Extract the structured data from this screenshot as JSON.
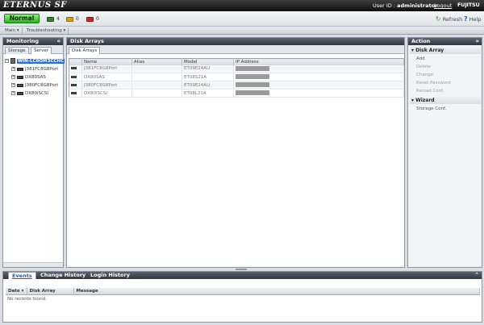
{
  "header": {
    "brand": "ETERNUS SF",
    "user_label": "User ID : ",
    "user_id": "administrator",
    "logout": "Logout",
    "vendor": "FUJITSU"
  },
  "status": {
    "normal": "Normal",
    "counters": [
      {
        "icon": "normal-status-icon",
        "value": "4",
        "color": "#3a7a32"
      },
      {
        "icon": "warning-status-icon",
        "value": "0",
        "color": "#d2a21c"
      },
      {
        "icon": "error-status-icon",
        "value": "0",
        "color": "#cc2a1f"
      }
    ],
    "refresh": "Refresh",
    "help": "Help"
  },
  "menu": [
    "Main",
    "Troubleshooting"
  ],
  "monitoring": {
    "title": "Monitoring",
    "tabs": [
      "Storage",
      "Server"
    ],
    "tree": {
      "root": "WIN-LC8OM3CCHC",
      "children": [
        "J381FC8G8Port",
        "DX80SAS",
        "J380FC8G8Port",
        "DX80iSCSI"
      ]
    }
  },
  "disk_arrays": {
    "title": "Disk Arrays",
    "tab": "Disk Arrays",
    "columns": [
      "Name",
      "Alias",
      "Model",
      "IP Address"
    ],
    "rows": [
      {
        "name": "J381FC8G8Port",
        "alias": "",
        "model": "ET09E24AU"
      },
      {
        "name": "DX80SAS",
        "alias": "",
        "model": "ET08S21A"
      },
      {
        "name": "J380FC8G8Port",
        "alias": "",
        "model": "ET09E24AU"
      },
      {
        "name": "DX80iSCSI",
        "alias": "",
        "model": "ET08L21A"
      }
    ]
  },
  "action": {
    "title": "Action",
    "groups": [
      {
        "label": "Disk Array",
        "items": [
          {
            "label": "Add",
            "enabled": true
          },
          {
            "label": "Delete",
            "enabled": false
          },
          {
            "label": "Change",
            "enabled": false
          },
          {
            "label": "Reset Password",
            "enabled": false
          },
          {
            "label": "Reload Conf.",
            "enabled": false
          }
        ]
      },
      {
        "label": "Wizard",
        "items": [
          {
            "label": "Storage Conf.",
            "enabled": true
          }
        ]
      }
    ]
  },
  "bottom": {
    "tabs": [
      "Events",
      "Change History",
      "Login History"
    ],
    "columns": [
      "Date",
      "Disk Array",
      "Message"
    ],
    "empty": "No records found."
  },
  "colors": {
    "accent": "#2a6fd6",
    "normal_green": "#2bb21d",
    "panel_header": "#2f3740"
  }
}
